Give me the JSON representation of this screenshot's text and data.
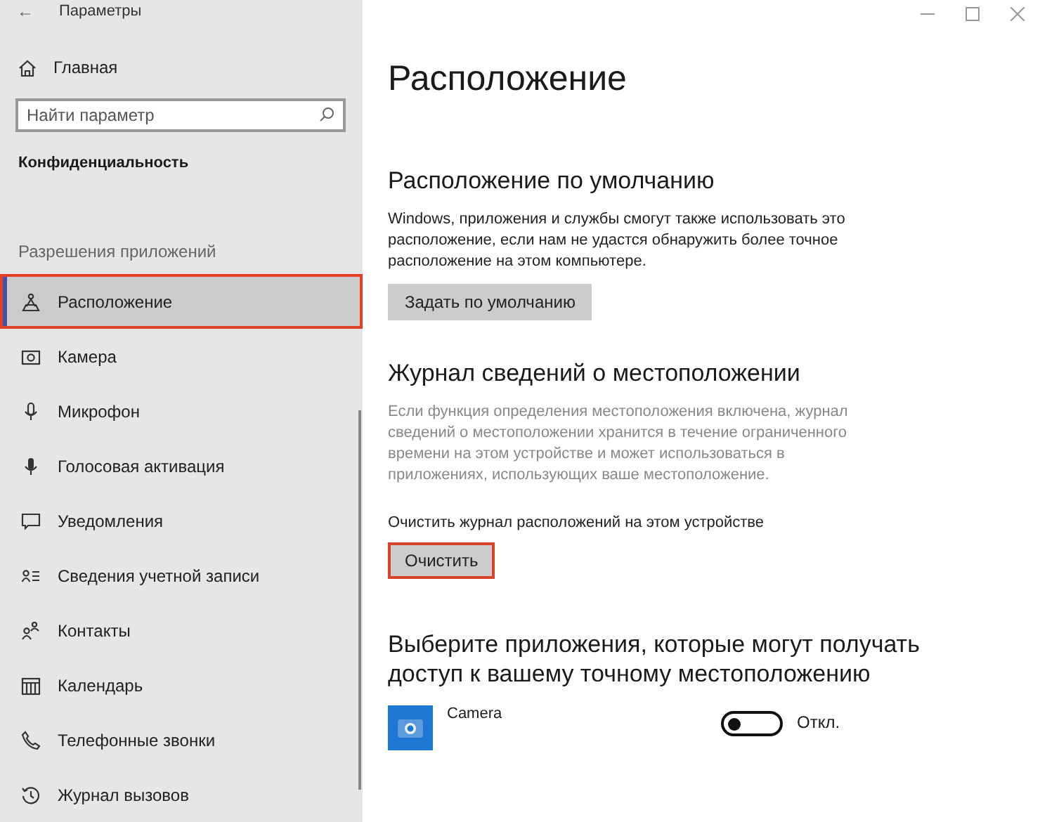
{
  "window": {
    "title": "Параметры",
    "back": "←"
  },
  "sidebar": {
    "home": "Главная",
    "search": {
      "placeholder": "Найти параметр"
    },
    "section": "Конфиденциальность",
    "group": "Разрешения приложений",
    "items": [
      {
        "label": "Расположение",
        "kind": "location",
        "selected": true,
        "highlighted": true
      },
      {
        "label": "Камера",
        "kind": "camera",
        "selected": false,
        "highlighted": false
      },
      {
        "label": "Микрофон",
        "kind": "mic",
        "selected": false,
        "highlighted": false
      },
      {
        "label": "Голосовая активация",
        "kind": "voice",
        "selected": false,
        "highlighted": false
      },
      {
        "label": "Уведомления",
        "kind": "notify",
        "selected": false,
        "highlighted": false
      },
      {
        "label": "Сведения учетной записи",
        "kind": "account",
        "selected": false,
        "highlighted": false
      },
      {
        "label": "Контакты",
        "kind": "contacts",
        "selected": false,
        "highlighted": false
      },
      {
        "label": "Календарь",
        "kind": "calendar",
        "selected": false,
        "highlighted": false
      },
      {
        "label": "Телефонные звонки",
        "kind": "phone",
        "selected": false,
        "highlighted": false
      },
      {
        "label": "Журнал вызовов",
        "kind": "history",
        "selected": false,
        "highlighted": false
      }
    ]
  },
  "page": {
    "title": "Расположение",
    "default_section": {
      "heading": "Расположение по умолчанию",
      "text": "Windows, приложения и службы смогут также использовать это расположение, если нам не удастся обнаружить более точное расположение на этом компьютере.",
      "button": {
        "label": "Задать по умолчанию",
        "highlighted": false
      }
    },
    "history_section": {
      "heading": "Журнал сведений о местоположении",
      "text": "Если функция определения местоположения включена, журнал сведений о местоположении хранится в течение ограниченного времени на этом устройстве и может использоваться в приложениях, использующих ваше местоположение.",
      "label": "Очистить журнал расположений на этом устройстве",
      "button": {
        "label": "Очистить",
        "highlighted": true
      }
    },
    "apps_section": {
      "heading": "Выберите приложения, которые могут получать доступ к вашему точному местоположению",
      "apps": [
        {
          "name": "Camera",
          "on": false,
          "state": "Откл."
        }
      ]
    }
  }
}
